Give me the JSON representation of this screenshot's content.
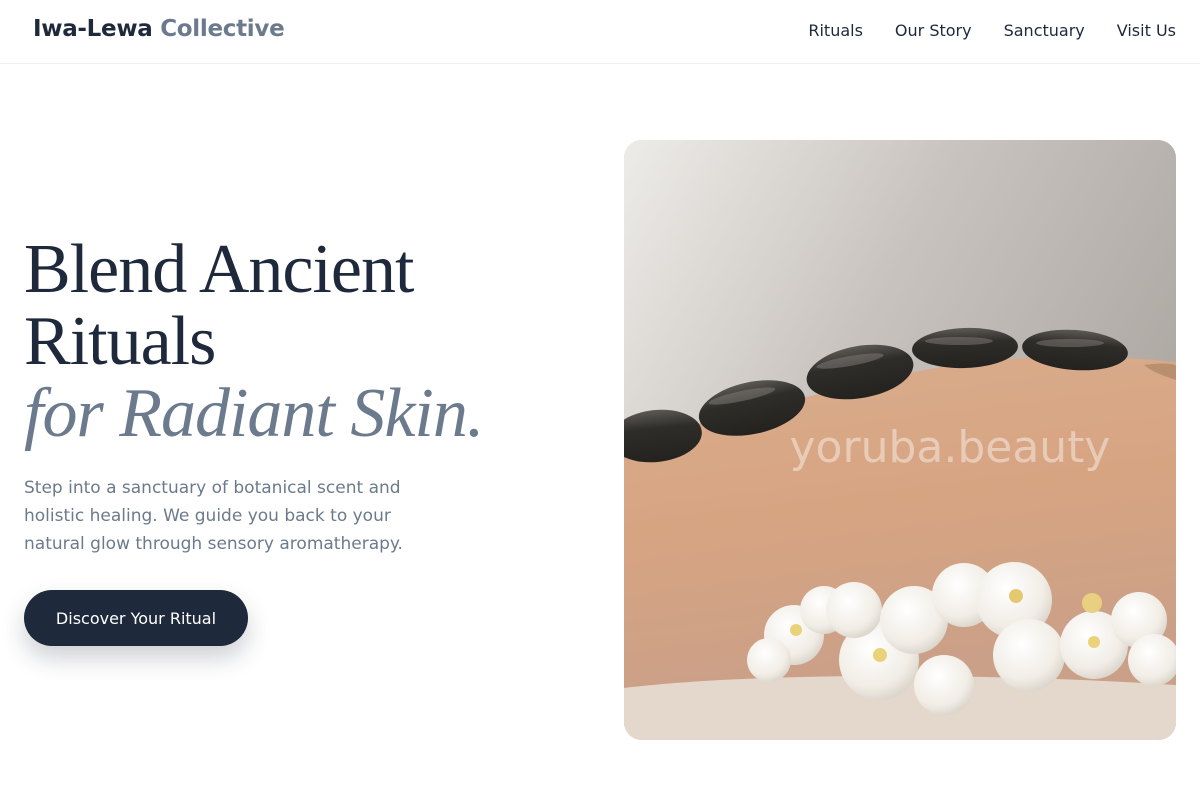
{
  "header": {
    "logo_primary": "Iwa-Lewa",
    "logo_accent": "Collective",
    "nav": [
      {
        "label": "Rituals"
      },
      {
        "label": "Our Story"
      },
      {
        "label": "Sanctuary"
      },
      {
        "label": "Visit Us"
      }
    ]
  },
  "hero": {
    "headline_line1": "Blend Ancient",
    "headline_line2": "Rituals",
    "headline_line3": "for Radiant Skin.",
    "description": "Step into a sanctuary of botanical scent and holistic healing. We guide you back to your natural glow through sensory aromatherapy.",
    "cta_label": "Discover Your Ritual",
    "image_watermark": "yoruba.beauty"
  },
  "colors": {
    "primary": "#1e293b",
    "accent": "#6b7a8c",
    "background": "#ffffff"
  }
}
